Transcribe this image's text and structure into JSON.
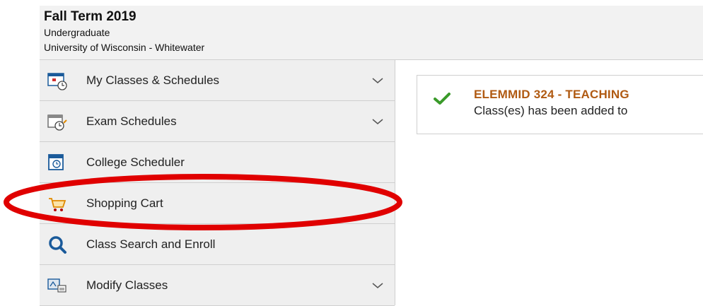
{
  "header": {
    "term": "Fall Term 2019",
    "career": "Undergraduate",
    "institution": "University of Wisconsin - Whitewater"
  },
  "sidebar": {
    "items": [
      {
        "label": "My Classes & Schedules",
        "icon": "calendar-clock-icon",
        "has_chevron": true
      },
      {
        "label": "Exam Schedules",
        "icon": "exam-calendar-icon",
        "has_chevron": true
      },
      {
        "label": "College Scheduler",
        "icon": "scheduler-calendar-icon",
        "has_chevron": false
      },
      {
        "label": "Shopping Cart",
        "icon": "shopping-cart-icon",
        "has_chevron": false
      },
      {
        "label": "Class Search and Enroll",
        "icon": "search-icon",
        "has_chevron": false
      },
      {
        "label": "Modify Classes",
        "icon": "modify-classes-icon",
        "has_chevron": true
      }
    ]
  },
  "message": {
    "icon": "checkmark-icon",
    "title": "ELEMMID  324 - TEACHING",
    "text": "Class(es) has been added to"
  },
  "annotation": {
    "highlight_color": "#e00000",
    "highlighted_item": "Shopping Cart"
  },
  "colors": {
    "accent": "#b05a12",
    "success": "#3a9a2a",
    "icon_blue": "#1a5a9a"
  }
}
